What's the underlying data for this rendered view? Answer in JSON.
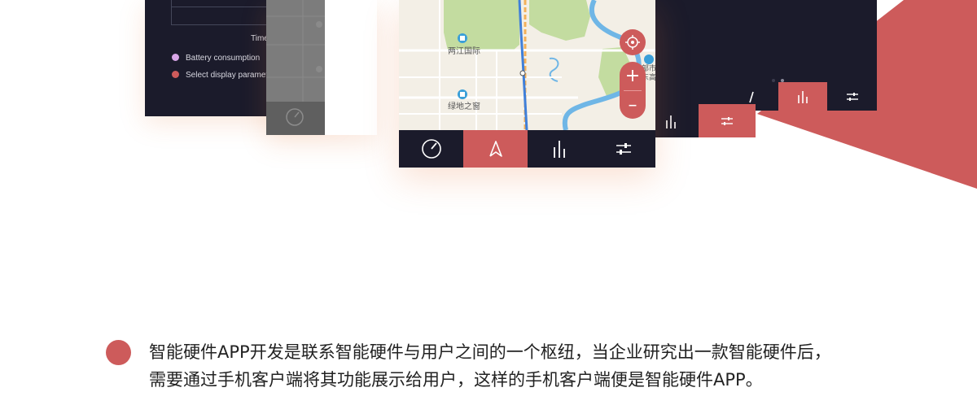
{
  "colors": {
    "accent": "#cd5b5b",
    "dark_panel": "#1b1b2b",
    "map_bg": "#f3efe6",
    "park": "#c3dca0",
    "water": "#6fb6e6"
  },
  "left_screen": {
    "axis_label": "Time",
    "legend": [
      {
        "label": "Battery consumption",
        "color": "#d9a6e8"
      },
      {
        "label": "Select display paramete",
        "color": "#cd5b5b"
      }
    ]
  },
  "map": {
    "poi_1": "两江国际",
    "poi_2": "绿地之窗",
    "poi_3_line1": "部市",
    "poi_3_line2": "东高"
  },
  "map_controls": {
    "zoom_in": "+",
    "zoom_out": "–"
  },
  "nav_icons": [
    "speedometer-icon",
    "navigation-arrow-icon",
    "bar-chart-icon",
    "sliders-icon"
  ],
  "description": {
    "line1": "智能硬件APP开发是联系智能硬件与用户之间的一个枢纽，当企业研究出一款智能硬件后，",
    "line2": "需要通过手机客户端将其功能展示给用户，这样的手机客户端便是智能硬件APP。"
  }
}
